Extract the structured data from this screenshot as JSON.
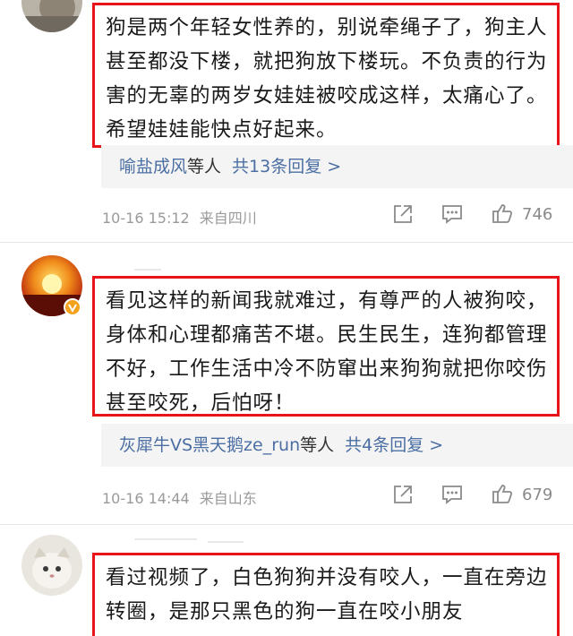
{
  "comments": [
    {
      "text": "狗是两个年轻女性养的，别说牵绳子了，狗主人甚至都没下楼，就把狗放下楼玩。不负责的行为害的无辜的两岁女娃娃被咬成这样，太痛心了。希望娃娃能快点好起来。",
      "replies": {
        "names": "喻盐成风",
        "etc": "等人",
        "count": "共13条回复 >"
      },
      "time": "10-16 15:12",
      "source": "来自四川",
      "likes": "746"
    },
    {
      "text": "看见这样的新闻我就难过，有尊严的人被狗咬，身体和心理都痛苦不堪。民生民生，连狗都管理不好，工作生活中冷不防窜出来狗狗就把你咬伤甚至咬死，后怕呀！",
      "replies": {
        "names": "灰犀牛VS黑天鹅ze_run",
        "etc": "等人",
        "count": "共4条回复 >"
      },
      "time": "10-16 14:44",
      "source": "来自山东",
      "likes": "679"
    },
    {
      "text": "看过视频了，白色狗狗并没有咬人，一直在旁边转圈，是那只黑色的狗一直在咬小朋友"
    }
  ],
  "icons": {
    "share": "share-icon",
    "comment": "comment-icon",
    "like": "thumbs-up-icon",
    "verified": "verified-badge-icon"
  },
  "colors": {
    "highlight_border": "#e8141a",
    "link": "#4b6ea3",
    "meta": "#9a9a9a"
  }
}
